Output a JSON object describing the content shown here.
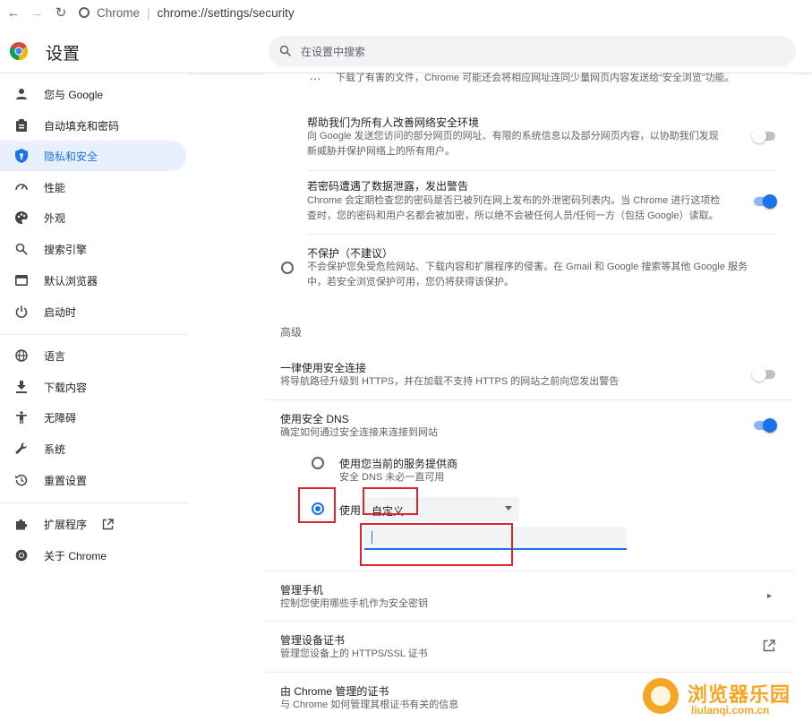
{
  "browser": {
    "tab_site_label": "Chrome",
    "url": "chrome://settings/security"
  },
  "header": {
    "title": "设置",
    "search_placeholder": "在设置中搜索"
  },
  "sidebar": {
    "items": [
      {
        "label": "您与 Google",
        "icon": "person-icon"
      },
      {
        "label": "自动填充和密码",
        "icon": "clipboard-icon"
      },
      {
        "label": "隐私和安全",
        "icon": "shield-icon",
        "active": true
      },
      {
        "label": "性能",
        "icon": "speedometer-icon"
      },
      {
        "label": "外观",
        "icon": "palette-icon"
      },
      {
        "label": "搜索引擎",
        "icon": "search-icon"
      },
      {
        "label": "默认浏览器",
        "icon": "browser-window-icon"
      },
      {
        "label": "启动时",
        "icon": "power-icon"
      },
      {
        "label": "语言",
        "icon": "globe-icon"
      },
      {
        "label": "下载内容",
        "icon": "download-icon"
      },
      {
        "label": "无障碍",
        "icon": "accessibility-icon"
      },
      {
        "label": "系统",
        "icon": "wrench-icon"
      },
      {
        "label": "重置设置",
        "icon": "reset-icon"
      },
      {
        "label": "扩展程序",
        "icon": "puzzle-icon"
      },
      {
        "label": "关于 Chrome",
        "icon": "chrome-icon"
      }
    ]
  },
  "main": {
    "top_text": "下载了有害的文件，Chrome 可能还会将相应网址连同少量网页内容发送给“安全浏览”功能。",
    "improve": {
      "title": "帮助我们为所有人改善网络安全环境",
      "desc_line1": "向 Google 发送您访问的部分网页的网址、有限的系统信息以及部分网页内容，以协助我们发现",
      "desc_line2": "新威胁并保护网络上的所有用户。",
      "enabled": false
    },
    "leak": {
      "title": "若密码遭遇了数据泄露，发出警告",
      "desc_line1": "Chrome 会定期检查您的密码是否已被列在网上发布的外泄密码列表内。当 Chrome 进行这项检",
      "desc_line2": "查时，您的密码和用户名都会被加密，所以绝不会被任何人员/任何一方（包括 Google）读取。",
      "enabled": true
    },
    "no_protection": {
      "title": "不保护（不建议）",
      "desc_line1": "不会保护您免受危险网站、下载内容和扩展程序的侵害。在 Gmail 和 Google 搜索等其他 Google 服务",
      "desc_line2": "中，若安全浏览保护可用，您仍将获得该保护。"
    },
    "advanced_label": "高级",
    "https": {
      "title": "一律使用安全连接",
      "desc": "将导航路径升级到 HTTPS，并在加载不支持 HTTPS 的网站之前向您发出警告",
      "enabled": false
    },
    "dns": {
      "title": "使用安全 DNS",
      "desc": "确定如何通过安全连接来连接到网站",
      "enabled": true,
      "option_current_title": "使用您当前的服务提供商",
      "option_current_desc": "安全 DNS 未必一直可用",
      "option_custom_label": "使用",
      "provider_value": "自定义",
      "custom_value": ""
    },
    "manage_phones": {
      "title": "管理手机",
      "desc": "控制您使用哪些手机作为安全密钥"
    },
    "manage_certs": {
      "title": "管理设备证书",
      "desc": "管理您设备上的 HTTPS/SSL 证书"
    },
    "chrome_certs": {
      "title": "由 Chrome 管理的证书",
      "desc": "与 Chrome 如何管理其根证书有关的信息"
    }
  },
  "watermark": {
    "title": "浏览器乐园",
    "url": "liulanqi.com.cn"
  },
  "colors": {
    "accent": "#1a73e8",
    "annotation_red": "#e0242b",
    "active_nav_bg": "#e8f0fe",
    "watermark_orange": "#f5a623"
  }
}
